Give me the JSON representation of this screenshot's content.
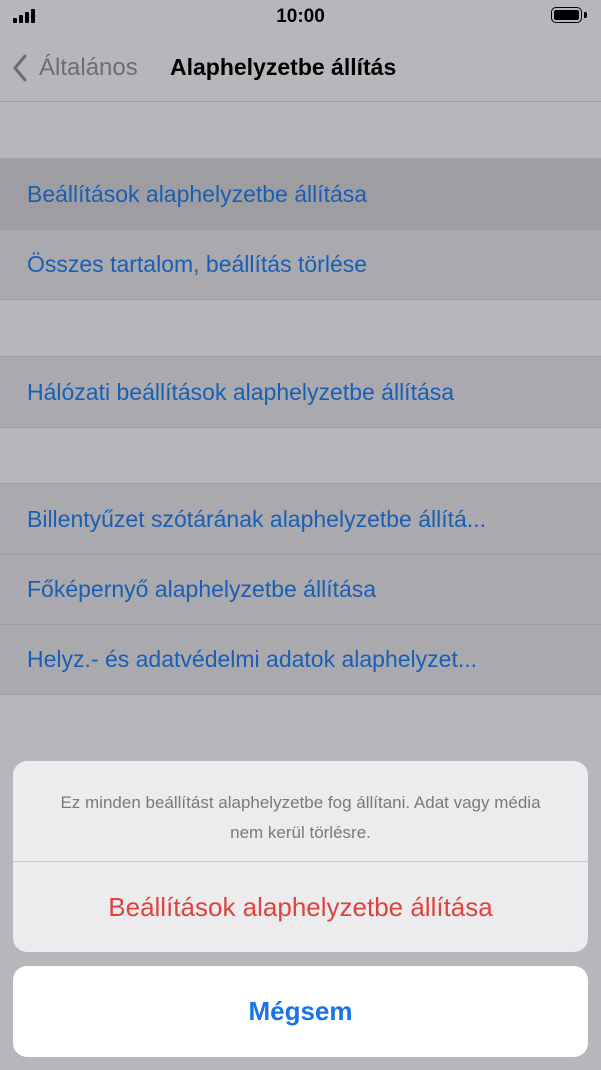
{
  "status_bar": {
    "time": "10:00",
    "signal_bars": 4,
    "battery_level": 1.0
  },
  "nav": {
    "back_label": "Általános",
    "title": "Alaphelyzetbe állítás"
  },
  "groups": [
    {
      "items": [
        {
          "label": "Beállítások alaphelyzetbe állítása",
          "highlighted": true
        },
        {
          "label": "Összes tartalom, beállítás törlése",
          "highlighted": false
        }
      ]
    },
    {
      "items": [
        {
          "label": "Hálózati beállítások alaphelyzetbe állítása",
          "highlighted": false
        }
      ]
    },
    {
      "items": [
        {
          "label": "Billentyűzet szótárának alaphelyzetbe állítá...",
          "highlighted": false
        },
        {
          "label": "Főképernyő alaphelyzetbe állítása",
          "highlighted": false
        },
        {
          "label": "Helyz.- és adatvédelmi adatok alaphelyzet...",
          "highlighted": false
        }
      ]
    }
  ],
  "action_sheet": {
    "message": "Ez minden beállítást alaphelyzetbe fog állítani. Adat vagy média nem kerül törlésre.",
    "destructive_label": "Beállítások alaphelyzetbe állítása",
    "cancel_label": "Mégsem"
  },
  "colors": {
    "link": "#1a5fb4",
    "destructive": "#e0433e",
    "cancel": "#1a73e8"
  }
}
